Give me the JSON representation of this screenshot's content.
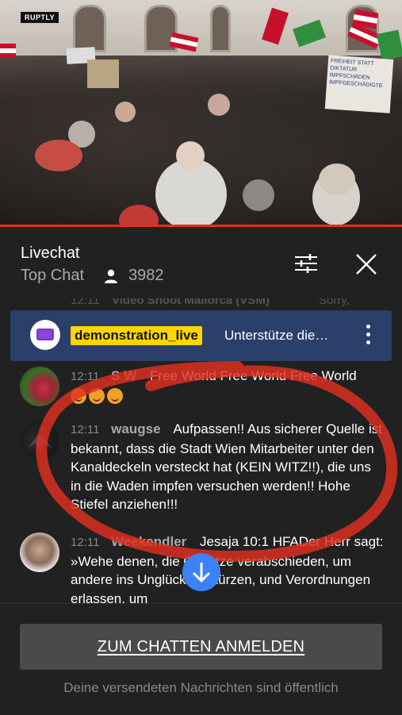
{
  "video": {
    "watermark": "RUPTLY",
    "progress_color": "#e0301e",
    "sign_text": "FREIHEIT STATT\nDIKTATUR\nIMPFSCHÄDEN\nIMPFGESCHÄDIGTE"
  },
  "header": {
    "title": "Livechat",
    "mode": "Top Chat",
    "viewer_icon": "person-icon",
    "viewer_count": "3982",
    "filter_icon": "sliders-icon",
    "close_icon": "close-icon"
  },
  "chat": {
    "faded_message": {
      "time": "12:11",
      "author": "Video Shoot Mallorca (VSM)",
      "text": "Sorry,"
    },
    "pinned": {
      "avatar_icon": "tv-icon",
      "channel": "demonstration_live",
      "text": "Unterstütze die…",
      "menu_icon": "more-vert-icon",
      "background": "#2b3f6b",
      "badge_color": "#ffd600"
    },
    "messages": [
      {
        "time": "12:11",
        "author": "S W",
        "text": "Free World Free World Free World"
      },
      {
        "time": "12:11",
        "author": "waugse",
        "text": "Aufpassen!! Aus sicherer Quelle ist bekannt, dass die Stadt Wien Mitarbeiter unter den Kanaldeckeln versteckt hat (KEIN WITZ!!), die uns in die Waden impfen versuchen werden!! Hohe Stiefel anziehen!!!"
      },
      {
        "time": "12:11",
        "author": "Weekendler",
        "text": "Jesaja 10:1 HFADer Herr sagt: »Wehe denen, die Gesetze verabschieden, um andere ins Unglück zu stürzen, und Verordnungen erlassen, um"
      }
    ],
    "scroll_icon": "arrow-down-icon",
    "scroll_color": "#3b82f6"
  },
  "footer": {
    "signin_label": "ZUM CHATTEN ANMELDEN",
    "note": "Deine versendeten Nachrichten sind öffentlich"
  },
  "colors": {
    "background": "#212121",
    "annotation": "#e0301e"
  }
}
